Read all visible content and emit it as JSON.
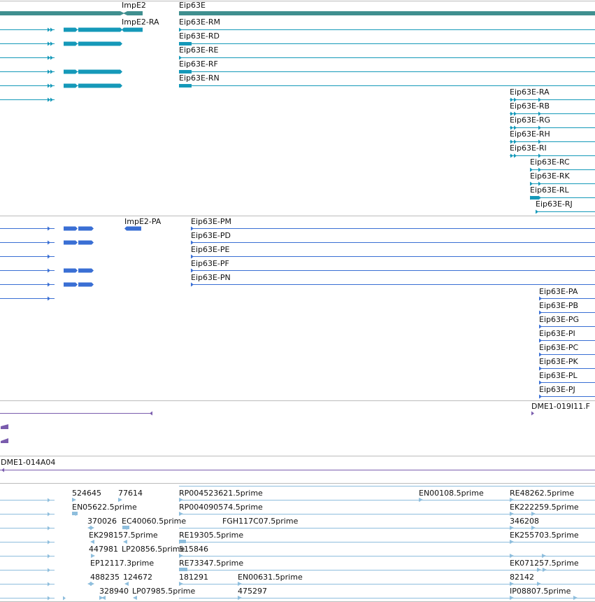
{
  "colors": {
    "gene": "#3f8f8f",
    "transcript": "#1599b9",
    "protein": "#3a6fd4",
    "clone": "#7a5cad",
    "est": "#8ebedd",
    "divider": "#bbbbbb"
  },
  "genes": {
    "impe2": "ImpE2",
    "eip63e": "Eip63E"
  },
  "transcripts": {
    "impe2_ra": "ImpE2-RA",
    "rm": "Eip63E-RM",
    "rd": "Eip63E-RD",
    "re": "Eip63E-RE",
    "rf": "Eip63E-RF",
    "rn": "Eip63E-RN",
    "ra": "Eip63E-RA",
    "rb": "Eip63E-RB",
    "rg": "Eip63E-RG",
    "rh": "Eip63E-RH",
    "ri": "Eip63E-RI",
    "rc": "Eip63E-RC",
    "rk": "Eip63E-RK",
    "rl": "Eip63E-RL",
    "rj": "Eip63E-RJ"
  },
  "proteins": {
    "impe2_pa": "ImpE2-PA",
    "pm": "Eip63E-PM",
    "pd": "Eip63E-PD",
    "pe": "Eip63E-PE",
    "pf": "Eip63E-PF",
    "pn": "Eip63E-PN",
    "pa": "Eip63E-PA",
    "pb": "Eip63E-PB",
    "pg": "Eip63E-PG",
    "pi": "Eip63E-PI",
    "pc": "Eip63E-PC",
    "pk": "Eip63E-PK",
    "pl": "Eip63E-PL",
    "pj": "Eip63E-PJ"
  },
  "clones": {
    "c1": "DME1-019I11.F",
    "c2": "DME1-014A04"
  },
  "ests": {
    "e1": "524645",
    "e2": "77614",
    "e3": "RP004523621.5prime",
    "e4": "EN00108.5prime",
    "e5": "RE48262.5prime",
    "e6": "EN05622.5prime",
    "e7": "RP004090574.5prime",
    "e8": "EK222259.5prime",
    "e9": "370026",
    "e10": "EC40060.5prime",
    "e11": "FGH117C07.5prime",
    "e12": "346208",
    "e13": "EK298157.5prime",
    "e14": "RE19305.5prime",
    "e15": "EK255703.5prime",
    "e16": "447981",
    "e17": "LP20856.5prime",
    "e18": "515846",
    "e19": "EP12117.3prime",
    "e20": "RE73347.5prime",
    "e21": "EK071257.5prime",
    "e22": "488235",
    "e23": "124672",
    "e24": "181291",
    "e25": "EN00631.5prime",
    "e26": "82142",
    "e27": "328940",
    "e28": "LP07985.5prime",
    "e29": "475297",
    "e30": "IP08807.5prime"
  }
}
